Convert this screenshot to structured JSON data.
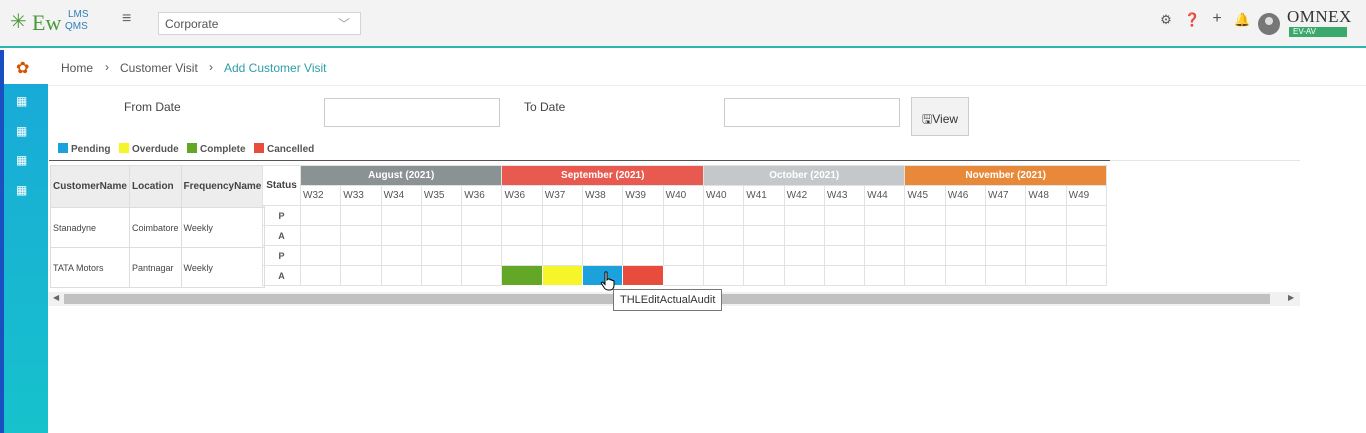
{
  "app": {
    "logo": {
      "main": "Ew",
      "lms": "LMS",
      "qms": "QMS"
    },
    "corporate_select": "Corporate",
    "brand": {
      "name": "OMNEX",
      "tag": "EV-AV"
    }
  },
  "header_icons": [
    "gear-icon",
    "help-icon",
    "plus-icon",
    "bell-icon"
  ],
  "breadcrumb": [
    "Home",
    "Customer Visit",
    "Add Customer Visit"
  ],
  "filters": {
    "from_label": "From Date",
    "from_value": "",
    "to_label": "To Date",
    "to_value": "",
    "view_label": "View"
  },
  "legend": [
    {
      "label": "Pending",
      "color": "#1ba1dc"
    },
    {
      "label": "Overdude",
      "color": "#f5f52a"
    },
    {
      "label": "Complete",
      "color": "#62a726"
    },
    {
      "label": "Cancelled",
      "color": "#e84c3d"
    }
  ],
  "table": {
    "columns": [
      "CustomerName",
      "Location",
      "FrequencyName"
    ],
    "rows": [
      {
        "customer": "Stanadyne",
        "location": "Coimbatore",
        "frequency": "Weekly"
      },
      {
        "customer": "TATA Motors",
        "location": "Pantnagar",
        "frequency": "Weekly"
      }
    ]
  },
  "gantt": {
    "status_label": "Status",
    "months": [
      {
        "label": "August (2021)",
        "color": "#8a9294",
        "weeks": [
          "W32",
          "W33",
          "W34",
          "W35",
          "W36"
        ]
      },
      {
        "label": "September (2021)",
        "color": "#e85a4f",
        "weeks": [
          "W36",
          "W37",
          "W38",
          "W39",
          "W40"
        ]
      },
      {
        "label": "October (2021)",
        "color": "#c4c8ca",
        "weeks": [
          "W40",
          "W41",
          "W42",
          "W43",
          "W44"
        ]
      },
      {
        "label": "November (2021)",
        "color": "#e8893a",
        "weeks": [
          "W45",
          "W46",
          "W47",
          "W48",
          "W49"
        ]
      }
    ],
    "row_labels": [
      "P",
      "A",
      "P",
      "A"
    ],
    "cells": [
      {
        "row": 3,
        "col": 5,
        "status": "Complete"
      },
      {
        "row": 3,
        "col": 6,
        "status": "Overdude"
      },
      {
        "row": 3,
        "col": 7,
        "status": "Pending"
      },
      {
        "row": 3,
        "col": 8,
        "status": "Cancelled"
      }
    ]
  },
  "tooltip": "THLEditActualAudit"
}
